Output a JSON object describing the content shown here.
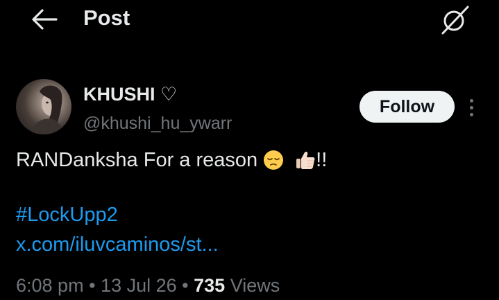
{
  "header": {
    "title": "Post",
    "back_icon": "arrow-left-icon",
    "grok_icon": "grok-icon"
  },
  "post": {
    "author": {
      "display_name": "KHUSHI ♡",
      "handle": "@khushi_hu_ywarr"
    },
    "follow_label": "Follow",
    "text": "RANDanksha For a reason",
    "text_suffix": "!!",
    "emojis": [
      "pensive-face-emoji",
      "thumbs-up-emoji"
    ],
    "hashtag": "#LockUpp2",
    "link": "x.com/iluvcaminos/st...",
    "time": "6:08 pm",
    "date": "13 Jul 26",
    "views_count": "735",
    "views_label": "Views",
    "separator": "•"
  },
  "colors": {
    "background": "#000000",
    "text_primary": "#e7e9ea",
    "text_secondary": "#71767b",
    "link": "#1d9bf0",
    "follow_bg": "#eff3f4"
  }
}
